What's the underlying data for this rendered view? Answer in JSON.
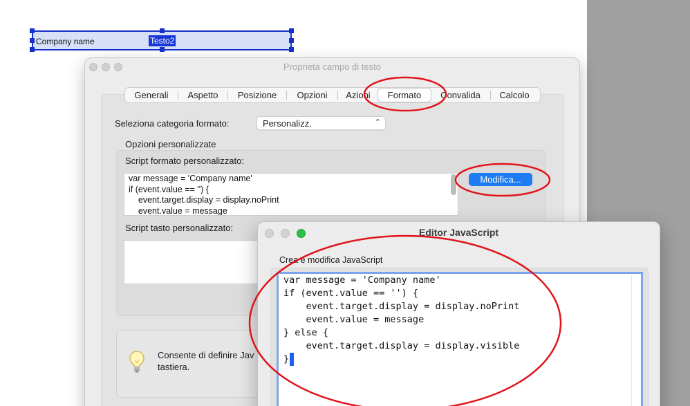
{
  "page_field": {
    "name_text": "Company name",
    "value_text": "Testo2"
  },
  "dialog": {
    "title": "Proprietà campo di testo",
    "tabs": [
      {
        "label": "Generali"
      },
      {
        "label": "Aspetto"
      },
      {
        "label": "Posizione"
      },
      {
        "label": "Opzioni"
      },
      {
        "label": "Azioni"
      },
      {
        "label": "Formato",
        "selected": true
      },
      {
        "label": "Convalida"
      },
      {
        "label": "Calcolo"
      }
    ],
    "format_category_label": "Seleziona categoria formato:",
    "format_category_value": "Personalizz.",
    "custom_options_heading": "Opzioni personalizzate",
    "custom_format_script_label": "Script formato personalizzato:",
    "custom_format_script_lines": [
      "var message = 'Company name'",
      "if (event.value == '') {",
      "    event.target.display = display.noPrint",
      "    event.value = message"
    ],
    "edit_button_label": "Modifica...",
    "custom_keystroke_script_label": "Script tasto personalizzato:",
    "tip_text_line1": "Consente di definire Jav",
    "tip_text_line2": "tastiera."
  },
  "js_editor": {
    "title": "Editor JavaScript",
    "subtitle": "Crea e modifica JavaScript",
    "code_lines": [
      "var message = 'Company name'",
      "if (event.value == '') {",
      "    event.target.display = display.noPrint",
      "    event.value = message",
      "} else {",
      "    event.target.display = display.visible",
      "}"
    ]
  },
  "colors": {
    "accent_blue": "#1d7cf2",
    "annotation_red": "#e0141b",
    "selection_blue": "#1737d8",
    "field_border": "#1730c9"
  },
  "icons": [
    "lightbulb-icon",
    "chevron-updown-icon",
    "close-traffic-light",
    "minimize-traffic-light",
    "zoom-traffic-light"
  ]
}
